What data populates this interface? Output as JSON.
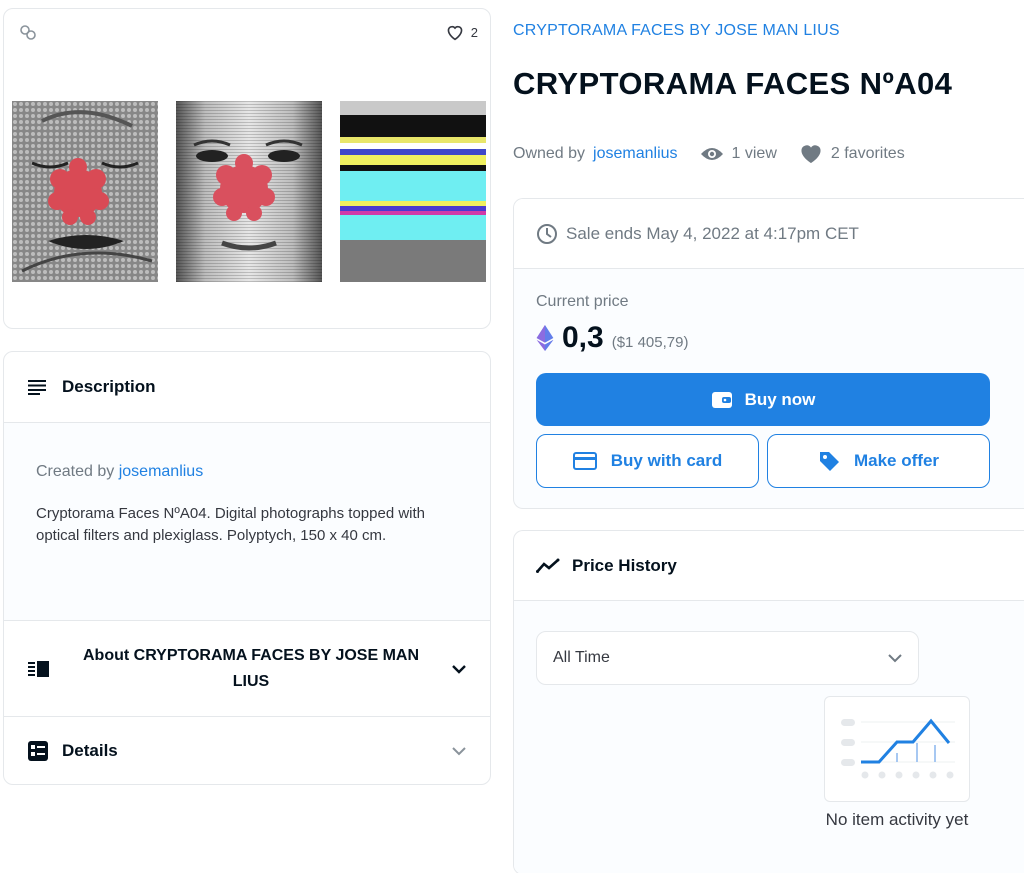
{
  "image_card": {
    "favorites_count": "2"
  },
  "description": {
    "header": "Description",
    "created_by_prefix": "Created by",
    "creator": "josemanlius",
    "text": "Cryptorama Faces NºA04. Digital photographs topped with optical filters and plexiglass. Polyptych, 150 x 40 cm."
  },
  "about": {
    "title": "About CRYPTORAMA FACES BY JOSE MAN LIUS"
  },
  "details": {
    "label": "Details"
  },
  "item": {
    "collection": "CRYPTORAMA FACES BY JOSE MAN LIUS",
    "title": "CRYPTORAMA FACES NºA04",
    "owned_by_prefix": "Owned by",
    "owner": "josemanlius",
    "views": "1 view",
    "favorites": "2 favorites"
  },
  "sale": {
    "ends": "Sale ends May 4, 2022 at 4:17pm CET",
    "current_price_label": "Current price",
    "price": "0,3",
    "fiat": "($1 405,79)",
    "buy_now": "Buy now",
    "buy_with_card": "Buy with card",
    "make_offer": "Make offer"
  },
  "price_history": {
    "header": "Price History",
    "range_selected": "All Time",
    "empty_message": "No item activity yet"
  },
  "colors": {
    "accent": "#2081e2",
    "text_primary": "#04111d",
    "text_secondary": "#707a83",
    "border": "#e5e8eb",
    "eth": "#627eea",
    "nose_red": "#d94a55"
  }
}
